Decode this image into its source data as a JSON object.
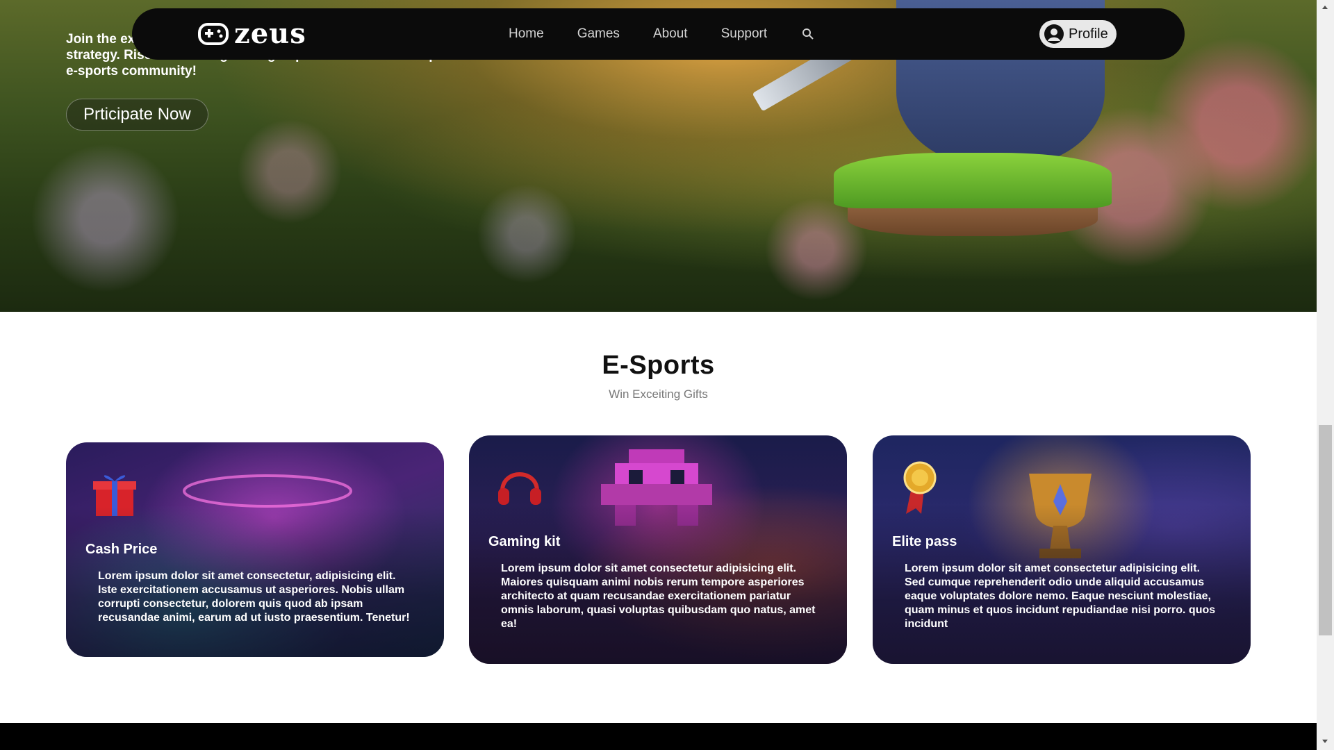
{
  "hero": {
    "text": "Join the excitement and dive into thrilling competitions, where skill meets strategy. Rise to new heights. Sign up now and become a part of our vibrant e-sports community!",
    "cta_label": "Prticipate Now"
  },
  "nav": {
    "logo_text": "zeus",
    "links": [
      "Home",
      "Games",
      "About",
      "Support"
    ],
    "profile_label": "Profile"
  },
  "section": {
    "title": "E-Sports",
    "subtitle": "Win Exceiting Gifts"
  },
  "cards": [
    {
      "title": "Cash Price",
      "body": "Lorem ipsum dolor sit amet consectetur, adipisicing elit. Iste exercitationem accusamus ut asperiores. Nobis ullam corrupti consectetur, dolorem quis quod ab ipsam recusandae animi, earum ad ut iusto praesentium. Tenetur!",
      "icon": "gift-icon"
    },
    {
      "title": "Gaming kit",
      "body": "Lorem ipsum dolor sit amet consectetur adipisicing elit. Maiores quisquam animi nobis rerum tempore asperiores architecto at quam recusandae exercitationem pariatur omnis laborum, quasi voluptas quibusdam quo natus, amet ea!",
      "icon": "headphones-icon"
    },
    {
      "title": "Elite pass",
      "body": "Lorem ipsum dolor sit amet consectetur adipisicing elit. Sed cumque reprehenderit odio unde aliquid accusamus eaque voluptates dolore nemo. Eaque nesciunt molestiae, quam minus et quos incidunt repudiandae nisi porro. quos incidunt",
      "icon": "medal-icon"
    }
  ],
  "colors": {
    "nav_bg": "#0b0b0b",
    "footer_bg": "#000000",
    "title_text": "#111111",
    "subtitle_text": "#777777"
  }
}
